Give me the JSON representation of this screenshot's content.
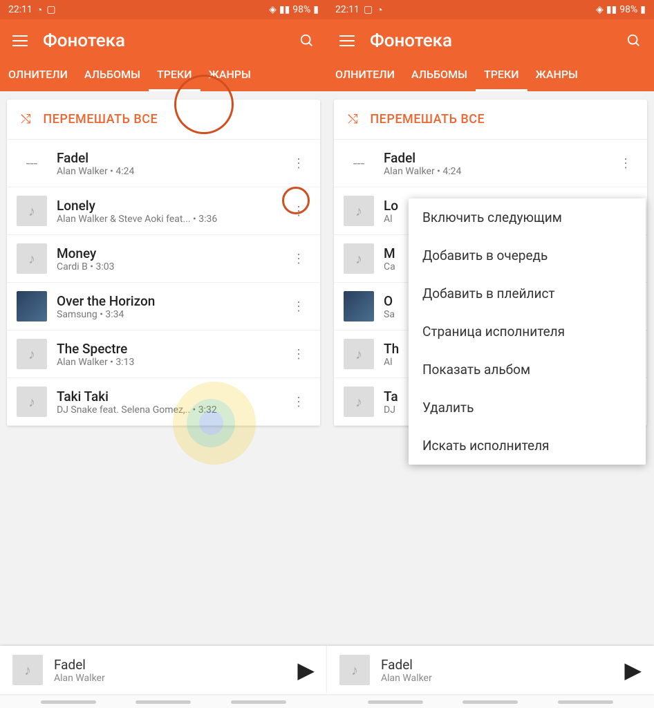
{
  "status": {
    "time": "22:11",
    "battery": "98%"
  },
  "header": {
    "title": "Фонотека"
  },
  "tabs": [
    "ОЛНИТЕЛИ",
    "АЛЬБОМЫ",
    "ТРЕКИ",
    "ЖАНРЫ"
  ],
  "shuffle": "ПЕРЕМЕШАТЬ ВСЕ",
  "tracks": [
    {
      "title": "Fadel",
      "sub": "Alan Walker • 4:24",
      "thumb": "empty"
    },
    {
      "title": "Lonely",
      "sub": "Alan Walker & Steve Aoki feat... • 3:36",
      "thumb": "note"
    },
    {
      "title": "Money",
      "sub": "Cardi B • 3:03",
      "thumb": "note"
    },
    {
      "title": "Over the Horizon",
      "sub": "Samsung • 3:34",
      "thumb": "img"
    },
    {
      "title": "The Spectre",
      "sub": "Alan Walker • 3:13",
      "thumb": "note"
    },
    {
      "title": "Taki Taki",
      "sub": "DJ Snake feat. Selena Gomez,.. • 3:32",
      "thumb": "note"
    }
  ],
  "tracks_short": [
    {
      "title": "Fadel",
      "sub": "Alan Walker • 4:24",
      "thumb": "empty"
    },
    {
      "title": "Lo",
      "sub": "Al",
      "thumb": "note"
    },
    {
      "title": "M",
      "sub": "Ca",
      "thumb": "note"
    },
    {
      "title": "O",
      "sub": "Sa",
      "thumb": "img"
    },
    {
      "title": "Th",
      "sub": "Al",
      "thumb": "note"
    },
    {
      "title": "Ta",
      "sub": "DJ",
      "thumb": "note"
    }
  ],
  "menu": [
    "Включить следующим",
    "Добавить в очередь",
    "Добавить в плейлист",
    "Страница исполнителя",
    "Показать альбом",
    "Удалить",
    "Искать исполнителя"
  ],
  "now_playing": {
    "title": "Fadel",
    "artist": "Alan Walker"
  }
}
